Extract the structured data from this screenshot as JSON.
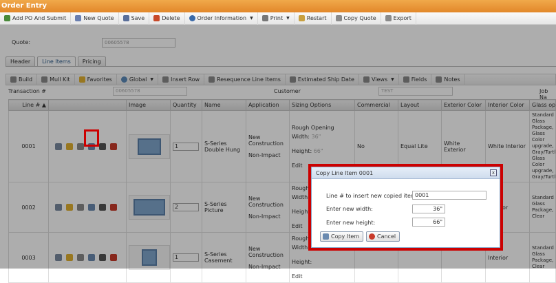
{
  "window": {
    "title": "Order Entry"
  },
  "toolbar": {
    "items": [
      {
        "label": "Add PO And Submit",
        "color": "#4a8a3a"
      },
      {
        "label": "New Quote",
        "color": "#6a7fb0"
      },
      {
        "label": "Save",
        "color": "#5a6f9a"
      },
      {
        "label": "Delete",
        "color": "#c84a2a"
      },
      {
        "label": "Order Information",
        "color": "#3a6aa8"
      },
      {
        "label": "Print",
        "color": "#777777"
      },
      {
        "label": "Restart",
        "color": "#c8a040"
      },
      {
        "label": "Copy Quote",
        "color": "#8a8a8a"
      },
      {
        "label": "Export",
        "color": "#8a8a8a"
      }
    ]
  },
  "quote": {
    "label": "Quote:",
    "value": "00605578"
  },
  "tabs": [
    "Header",
    "Line Items",
    "Pricing"
  ],
  "grid_toolbar": {
    "items": [
      "Build",
      "Mull Kit",
      "Favorites",
      "Global",
      "Insert Row",
      "Resequence Line Items",
      "Estimated Ship Date",
      "Views",
      "Fields",
      "Notes"
    ]
  },
  "transaction": {
    "label": "Transaction #",
    "value": "00605578",
    "customer_label": "Customer",
    "customer_value": "TEST",
    "jobname_label": "Job Na"
  },
  "columns": [
    "Line #",
    "",
    "Image",
    "Quantity",
    "Name",
    "Application",
    "Sizing Options",
    "Commercial",
    "Layout",
    "Exterior Color",
    "Interior Color",
    "Glass optio"
  ],
  "rows": [
    {
      "line": "0001",
      "quantity": "1",
      "name": "S-Series Double Hung",
      "application": "New Construction",
      "impact": "Non-Impact",
      "sizing_title": "Rough Opening",
      "width_label": "Width:",
      "width": "36\"",
      "height_label": "Height:",
      "height": "66\"",
      "edit": "Edit",
      "commercial": "No",
      "layout": "Equal Lite",
      "exterior": "White Exterior",
      "interior": "White Interior",
      "glass": "Standard Glass Package, Glass Color upgrade, Gray/Turtle, Glass Color upgrade, Gray/Turtle"
    },
    {
      "line": "0002",
      "quantity": "2",
      "name": "S-Series Picture",
      "application": "New Construction",
      "impact": "Non-Impact",
      "sizing_title": "Rough O",
      "width_label": "Width:",
      "width": "",
      "height_label": "Height:",
      "height": "",
      "edit": "Edit",
      "commercial": "",
      "layout": "",
      "exterior": "",
      "interior": "Interior",
      "glass": "Standard Glass Package, Clear"
    },
    {
      "line": "0003",
      "quantity": "1",
      "name": "S-Series Casement",
      "application": "New Construction",
      "impact": "Non-Impact",
      "sizing_title": "Rough O",
      "width_label": "Width:",
      "width": "",
      "height_label": "Height:",
      "height": "",
      "edit": "Edit",
      "commercial": "",
      "layout": "",
      "exterior": "",
      "interior": "Interior",
      "glass": "Standard Glass Package, Clear"
    }
  ],
  "dialog": {
    "title": "Copy Line Item 0001",
    "close": "x",
    "line_label": "Line # to insert new copied item at:",
    "line_value": "0001",
    "width_label": "Enter new width:",
    "width_value": "36\"",
    "height_label": "Enter new height:",
    "height_value": "66\"",
    "copy_button": "Copy Item",
    "cancel_button": "Cancel"
  }
}
